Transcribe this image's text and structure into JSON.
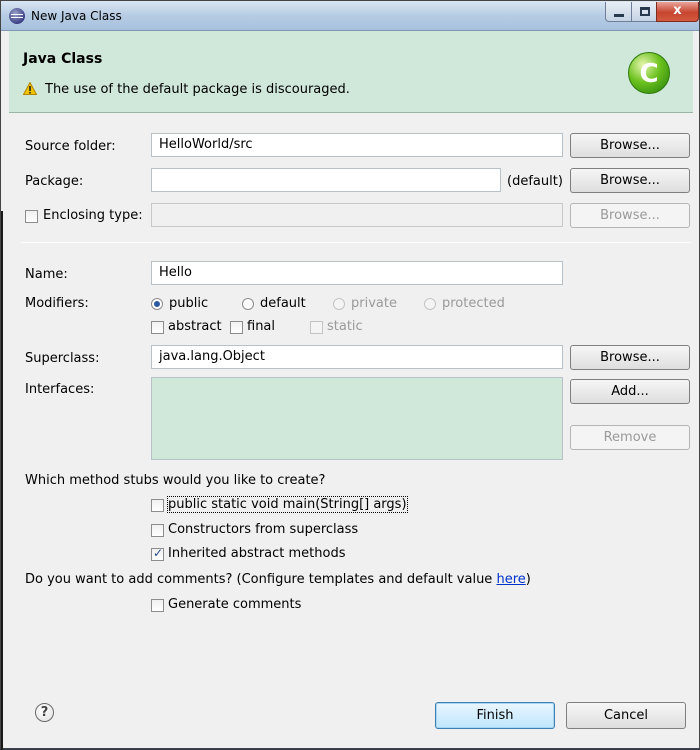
{
  "window": {
    "title": "New Java Class",
    "icon": "eclipse-icon",
    "minimize": "minimize-icon",
    "maximize": "maximize-icon",
    "close_glyph": "x"
  },
  "banner": {
    "title": "Java Class",
    "message": "The use of the default package is discouraged.",
    "warning_icon": "warning-icon",
    "logo_letter": "C",
    "logo_color": "#5cb31a",
    "background": "#cfe8da"
  },
  "source_folder": {
    "label": "Source folder:",
    "value": "HelloWorld/src",
    "browse_label": "Browse..."
  },
  "package": {
    "label": "Package:",
    "value": "",
    "hint": "(default)",
    "browse_label": "Browse..."
  },
  "enclosing_type": {
    "label": "Enclosing type:",
    "checked": false,
    "value": "",
    "browse_label": "Browse..."
  },
  "name": {
    "label": "Name:",
    "value": "Hello"
  },
  "modifiers": {
    "label": "Modifiers:",
    "access": [
      {
        "label": "public",
        "checked": true,
        "enabled": true
      },
      {
        "label": "default",
        "checked": false,
        "enabled": true
      },
      {
        "label": "private",
        "checked": false,
        "enabled": false
      },
      {
        "label": "protected",
        "checked": false,
        "enabled": false
      }
    ],
    "flags": [
      {
        "label": "abstract",
        "checked": false,
        "enabled": true
      },
      {
        "label": "final",
        "checked": false,
        "enabled": true
      },
      {
        "label": "static",
        "checked": false,
        "enabled": false
      }
    ]
  },
  "superclass": {
    "label": "Superclass:",
    "value": "java.lang.Object",
    "browse_label": "Browse..."
  },
  "interfaces": {
    "label": "Interfaces:",
    "add_label": "Add...",
    "remove_label": "Remove"
  },
  "method_stubs": {
    "question": "Which method stubs would you like to create?",
    "options": [
      {
        "label": "public static void main(String[] args)",
        "checked": false
      },
      {
        "label": "Constructors from superclass",
        "checked": false
      },
      {
        "label": "Inherited abstract methods",
        "checked": true
      }
    ]
  },
  "comments": {
    "question_prefix": "Do you want to add comments? (Configure templates and default value ",
    "link": "here",
    "question_suffix": ")",
    "option": {
      "label": "Generate comments",
      "checked": false
    }
  },
  "footer": {
    "help_glyph": "?",
    "finish_label": "Finish",
    "cancel_label": "Cancel"
  }
}
